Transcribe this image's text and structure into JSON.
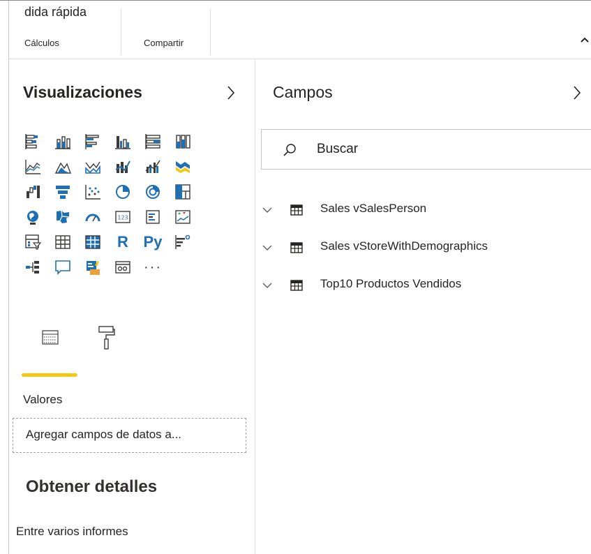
{
  "ribbon": {
    "cut_label": "dida  rápida",
    "groups": [
      "Cálculos",
      "Compartir"
    ]
  },
  "visualizations": {
    "title": "Visualizaciones",
    "icons": [
      "stacked-bar-chart-icon",
      "stacked-column-chart-icon",
      "clustered-bar-chart-icon",
      "clustered-column-chart-icon",
      "100-stacked-bar-chart-icon",
      "100-stacked-column-chart-icon",
      "line-chart-icon",
      "area-chart-icon",
      "stacked-area-chart-icon",
      "line-and-stacked-column-chart-icon",
      "line-and-clustered-column-chart-icon",
      "ribbon-chart-icon",
      "waterfall-chart-icon",
      "funnel-chart-icon",
      "scatter-chart-icon",
      "pie-chart-icon",
      "donut-chart-icon",
      "treemap-icon",
      "map-icon",
      "filled-map-icon",
      "gauge-icon",
      "card-icon",
      "multi-row-card-icon",
      "kpi-icon",
      "slicer-icon",
      "table-icon",
      "matrix-icon",
      "r-script-visual-icon",
      "python-visual-icon",
      "key-influencers-icon",
      "decomposition-tree-icon",
      "qa-icon",
      "smart-narrative-icon",
      "paginated-report-icon",
      "more-visuals-icon"
    ],
    "r_label": "R",
    "py_label": "Py",
    "more_label": "···",
    "tabs": [
      "fields-tab-icon",
      "format-paint-roller-icon"
    ],
    "values_label": "Valores",
    "drop_placeholder": "Agregar campos de datos a...",
    "details_title": "Obtener detalles",
    "details_subtitle": "Entre varios informes"
  },
  "fields": {
    "title": "Campos",
    "search_placeholder": "Buscar",
    "tables": [
      {
        "label": "Sales vSalesPerson"
      },
      {
        "label": "Sales vStoreWithDemographics"
      },
      {
        "label": "Top10 Productos Vendidos"
      }
    ]
  },
  "colors": {
    "accent_yellow": "#f2c811",
    "icon_blue": "#1f6fb5",
    "icon_dark": "#3b3a39",
    "text": "#252423"
  }
}
